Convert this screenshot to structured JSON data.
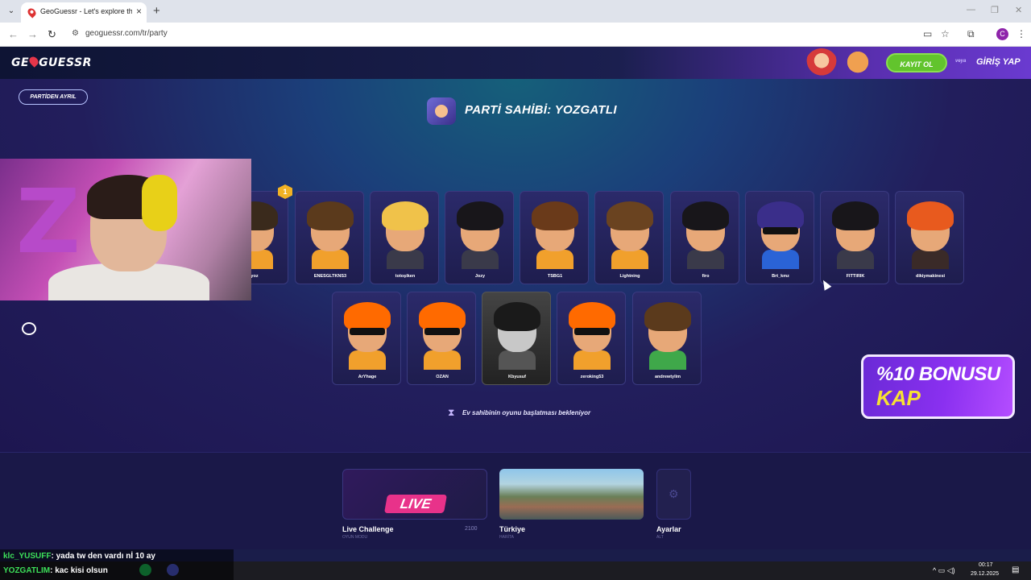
{
  "browser": {
    "tab_title": "GeoGuessr - Let's explore the w",
    "url": "geoguessr.com/tr/party",
    "profile_initial": "C"
  },
  "header": {
    "logo_left": "GE",
    "logo_right": "GUESSR",
    "register_label": "KAYIT OL",
    "or_label": "veya",
    "login_label": "GİRİŞ YAP"
  },
  "party": {
    "leave_label": "PARTİDEN AYRIL",
    "host_title": "PARTİ SAHİBİ: YOZGATLI",
    "host_badge": "1",
    "waiting_message": "Ev sahibinin oyunu başlatması bekleniyor"
  },
  "players_row1": [
    {
      "name": "yoz",
      "hair": "#3a2a1c",
      "body": "#f1a02c",
      "glasses": false
    },
    {
      "name": "ENESGLTKNS3",
      "hair": "#5b3a1c",
      "body": "#f1a02c",
      "glasses": false
    },
    {
      "name": "totoşiken",
      "hair": "#f0c24a",
      "body": "#3a3a4a",
      "glasses": false
    },
    {
      "name": "Jozy",
      "hair": "#18161a",
      "body": "#3a3a4a",
      "glasses": false
    },
    {
      "name": "TSBG1",
      "hair": "#6a3a1a",
      "body": "#f1a02c",
      "glasses": false
    },
    {
      "name": "Lightning",
      "hair": "#6a4320",
      "body": "#f1a02c",
      "glasses": false
    },
    {
      "name": "firo",
      "hair": "#18161a",
      "body": "#3a3a4a",
      "glasses": false
    },
    {
      "name": "Brt_kmz",
      "hair": "#3a2e8a",
      "body": "#2a63d6",
      "glasses": true
    },
    {
      "name": "FITTIRIK",
      "hair": "#18161a",
      "body": "#3a3a4a",
      "glasses": false
    },
    {
      "name": "dikiymakinesi",
      "hair": "#e85a1e",
      "body": "#3a2a28",
      "glasses": false
    }
  ],
  "players_row2": [
    {
      "name": "ArYhage",
      "hair": "#ff6a00",
      "body": "#f1a02c",
      "glasses": true,
      "grey": false
    },
    {
      "name": "OZAN",
      "hair": "#ff6a00",
      "body": "#f1a02c",
      "glasses": true,
      "grey": false
    },
    {
      "name": "Kbyusuf",
      "hair": "#1a1a1a",
      "body": "#555",
      "glasses": false,
      "grey": true
    },
    {
      "name": "zeroking53",
      "hair": "#ff6a00",
      "body": "#f1a02c",
      "glasses": true,
      "grey": false
    },
    {
      "name": "andrewtylim",
      "hair": "#5b3a1c",
      "body": "#3fa84a",
      "glasses": false,
      "grey": false
    }
  ],
  "promo": {
    "line1": "%10 BONUSU",
    "line2": "KAP"
  },
  "modes": {
    "live": {
      "tag": "LIVE",
      "title": "Live Challenge",
      "sub": "OYUN MODU",
      "count": "2100"
    },
    "turkey": {
      "title": "Türkiye",
      "sub": "HARİTA"
    },
    "settings": {
      "title": "Ayarlar",
      "sub": "ALT"
    }
  },
  "chat": [
    {
      "user": "klc_YUSUFF",
      "text": ": yada tw den vardı nİ 10 ay"
    },
    {
      "user": "YOZGATLIM",
      "text": ": kac kisi olsun"
    }
  ],
  "taskbar": {
    "time": "00:17",
    "date": "29.12.2025"
  },
  "colors": {
    "accent_green": "#62c42d",
    "brand_purple": "#6a2ad6",
    "badge_gold": "#f2b224"
  }
}
